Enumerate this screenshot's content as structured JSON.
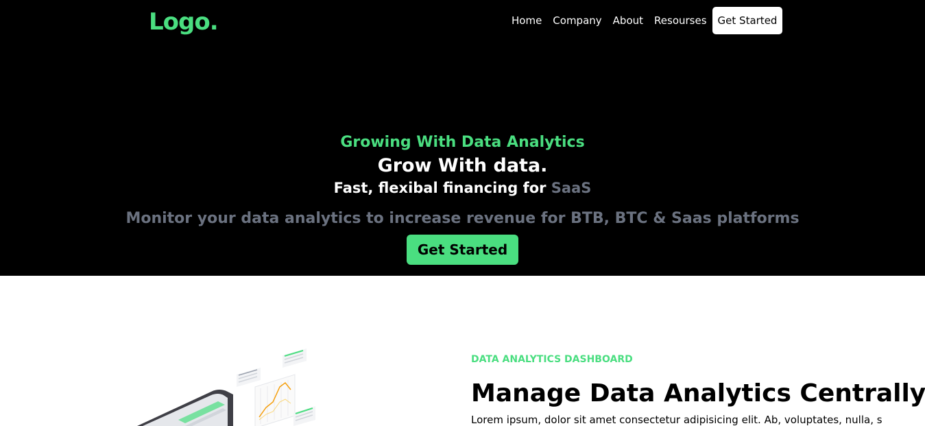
{
  "header": {
    "logo": "Logo.",
    "nav": [
      {
        "label": "Home"
      },
      {
        "label": "Company"
      },
      {
        "label": "About"
      },
      {
        "label": "Resourses"
      }
    ],
    "cta_label": "Get Started"
  },
  "hero": {
    "kicker": "Growing With Data Analytics",
    "headline": "Grow With data.",
    "subline_prefix": "Fast, flexibal financing for ",
    "subline_accent": "SaaS",
    "description": "Monitor your data analytics to increase revenue for BTB, BTC & Saas platforms",
    "button_label": "Get Started"
  },
  "section": {
    "kicker": "DATA ANALYTICS DASHBOARD",
    "title": "Manage Data Analytics Centrally",
    "body": "Lorem ipsum, dolor sit amet consectetur adipisicing elit. Ab, voluptates, nulla, sequi"
  },
  "colors": {
    "accent": "#4ade80",
    "muted": "#6b7280",
    "hero_bg": "#000000"
  }
}
